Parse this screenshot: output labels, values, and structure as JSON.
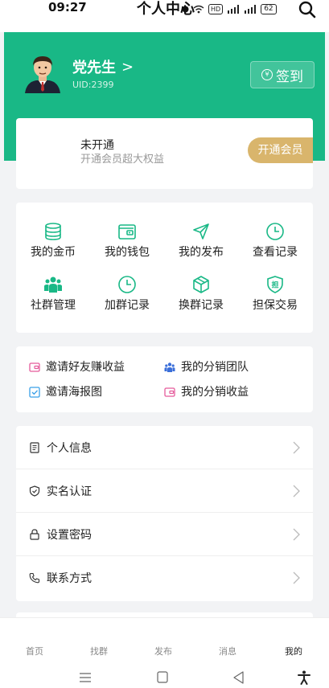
{
  "status_bar": {
    "time": "09:27",
    "title": "个人中心",
    "network_label": "HD",
    "battery": "62"
  },
  "header": {
    "user_name": "党先生",
    "name_chevron": ">",
    "uid": "UID:2399",
    "checkin_label": "签到",
    "bg_color": "#19b886"
  },
  "vip": {
    "status": "未开通",
    "subtitle": "开通会员超大权益",
    "button_label": "开通会员",
    "button_color": "#d9b56c"
  },
  "grid": {
    "items": [
      {
        "label": "我的金币",
        "icon": "coins-stack-icon"
      },
      {
        "label": "我的钱包",
        "icon": "wallet-icon"
      },
      {
        "label": "我的发布",
        "icon": "paper-plane-icon"
      },
      {
        "label": "查看记录",
        "icon": "clock-icon"
      },
      {
        "label": "社群管理",
        "icon": "group-people-icon"
      },
      {
        "label": "加群记录",
        "icon": "clock-icon"
      },
      {
        "label": "换群记录",
        "icon": "cube-icon"
      },
      {
        "label": "担保交易",
        "icon": "shield-guarantee-icon"
      }
    ]
  },
  "links": {
    "items": [
      {
        "label": "邀请好友赚收益",
        "icon": "wallet-pink-icon"
      },
      {
        "label": "我的分销团队",
        "icon": "team-icon"
      },
      {
        "label": "邀请海报图",
        "icon": "checkbox-icon"
      },
      {
        "label": "我的分销收益",
        "icon": "wallet-pink-icon"
      }
    ]
  },
  "menu": {
    "items": [
      {
        "label": "个人信息",
        "icon": "document-icon"
      },
      {
        "label": "实名认证",
        "icon": "shield-check-icon"
      },
      {
        "label": "设置密码",
        "icon": "lock-icon"
      },
      {
        "label": "联系方式",
        "icon": "phone-icon"
      }
    ]
  },
  "tabs": [
    {
      "label": "首页"
    },
    {
      "label": "找群"
    },
    {
      "label": "发布"
    },
    {
      "label": "消息"
    },
    {
      "label": "我的",
      "active": true
    }
  ]
}
